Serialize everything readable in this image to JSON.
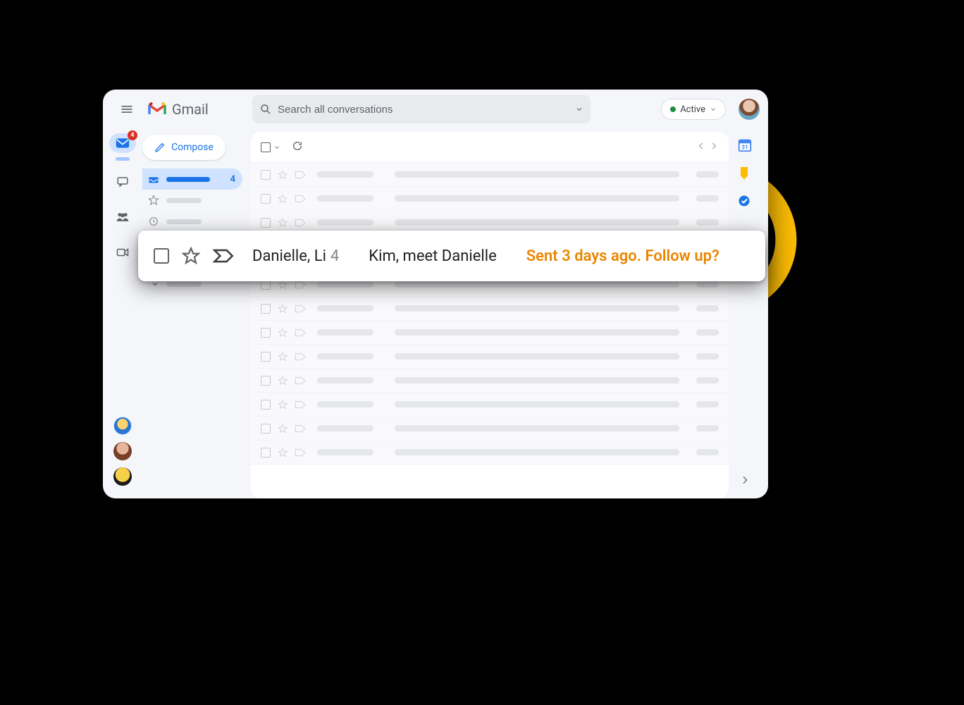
{
  "brand": {
    "name": "Gmail"
  },
  "search": {
    "placeholder": "Search all conversations"
  },
  "status": {
    "label": "Active"
  },
  "rail": {
    "mail_badge": "4"
  },
  "sidebar": {
    "compose_label": "Compose",
    "inbox_count": "4"
  },
  "nudge": {
    "participants": "Danielle, Li",
    "thread_count": "4",
    "subject": "Kim, meet Danielle",
    "hint": "Sent 3 days ago. Follow up?"
  }
}
